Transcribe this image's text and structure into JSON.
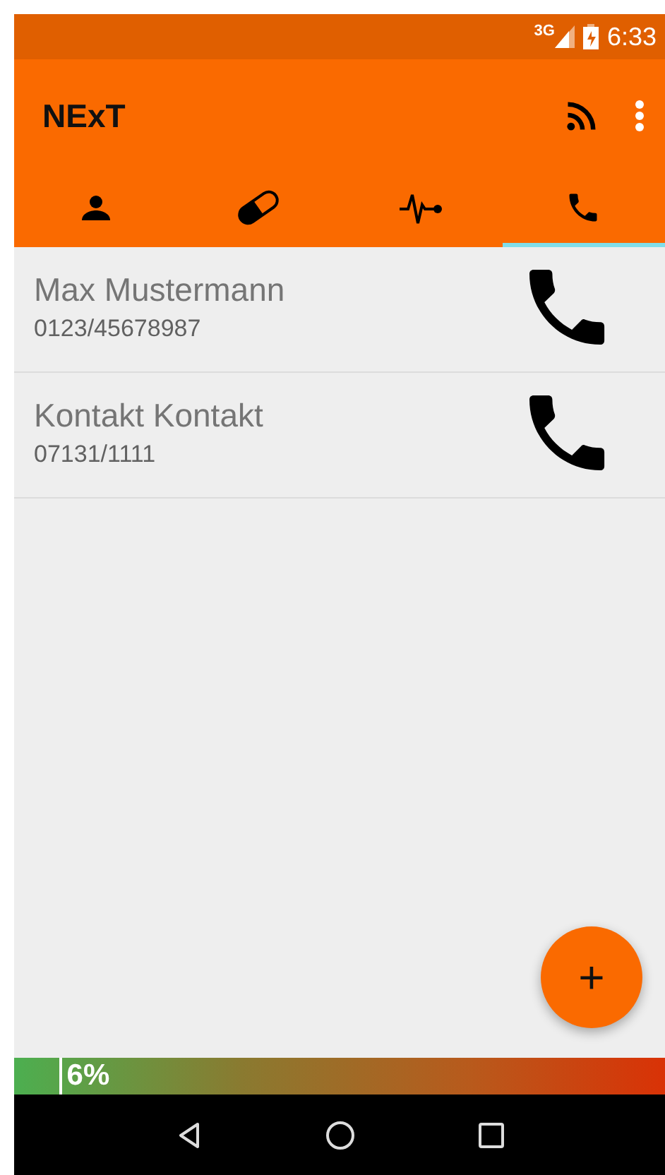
{
  "status_bar": {
    "network": "3G",
    "time": "6:33"
  },
  "app_bar": {
    "title": "NExT"
  },
  "tabs": [
    {
      "kind": "person",
      "selected": false
    },
    {
      "kind": "pill",
      "selected": false
    },
    {
      "kind": "pulse",
      "selected": false
    },
    {
      "kind": "phone",
      "selected": true
    }
  ],
  "contacts": [
    {
      "name": "Max Mustermann",
      "phone": "0123/45678987"
    },
    {
      "name": "Kontakt Kontakt",
      "phone": "07131/1111"
    }
  ],
  "fab": {
    "label": "+"
  },
  "battery_bar": {
    "level": 0.07,
    "reading": "6%"
  }
}
